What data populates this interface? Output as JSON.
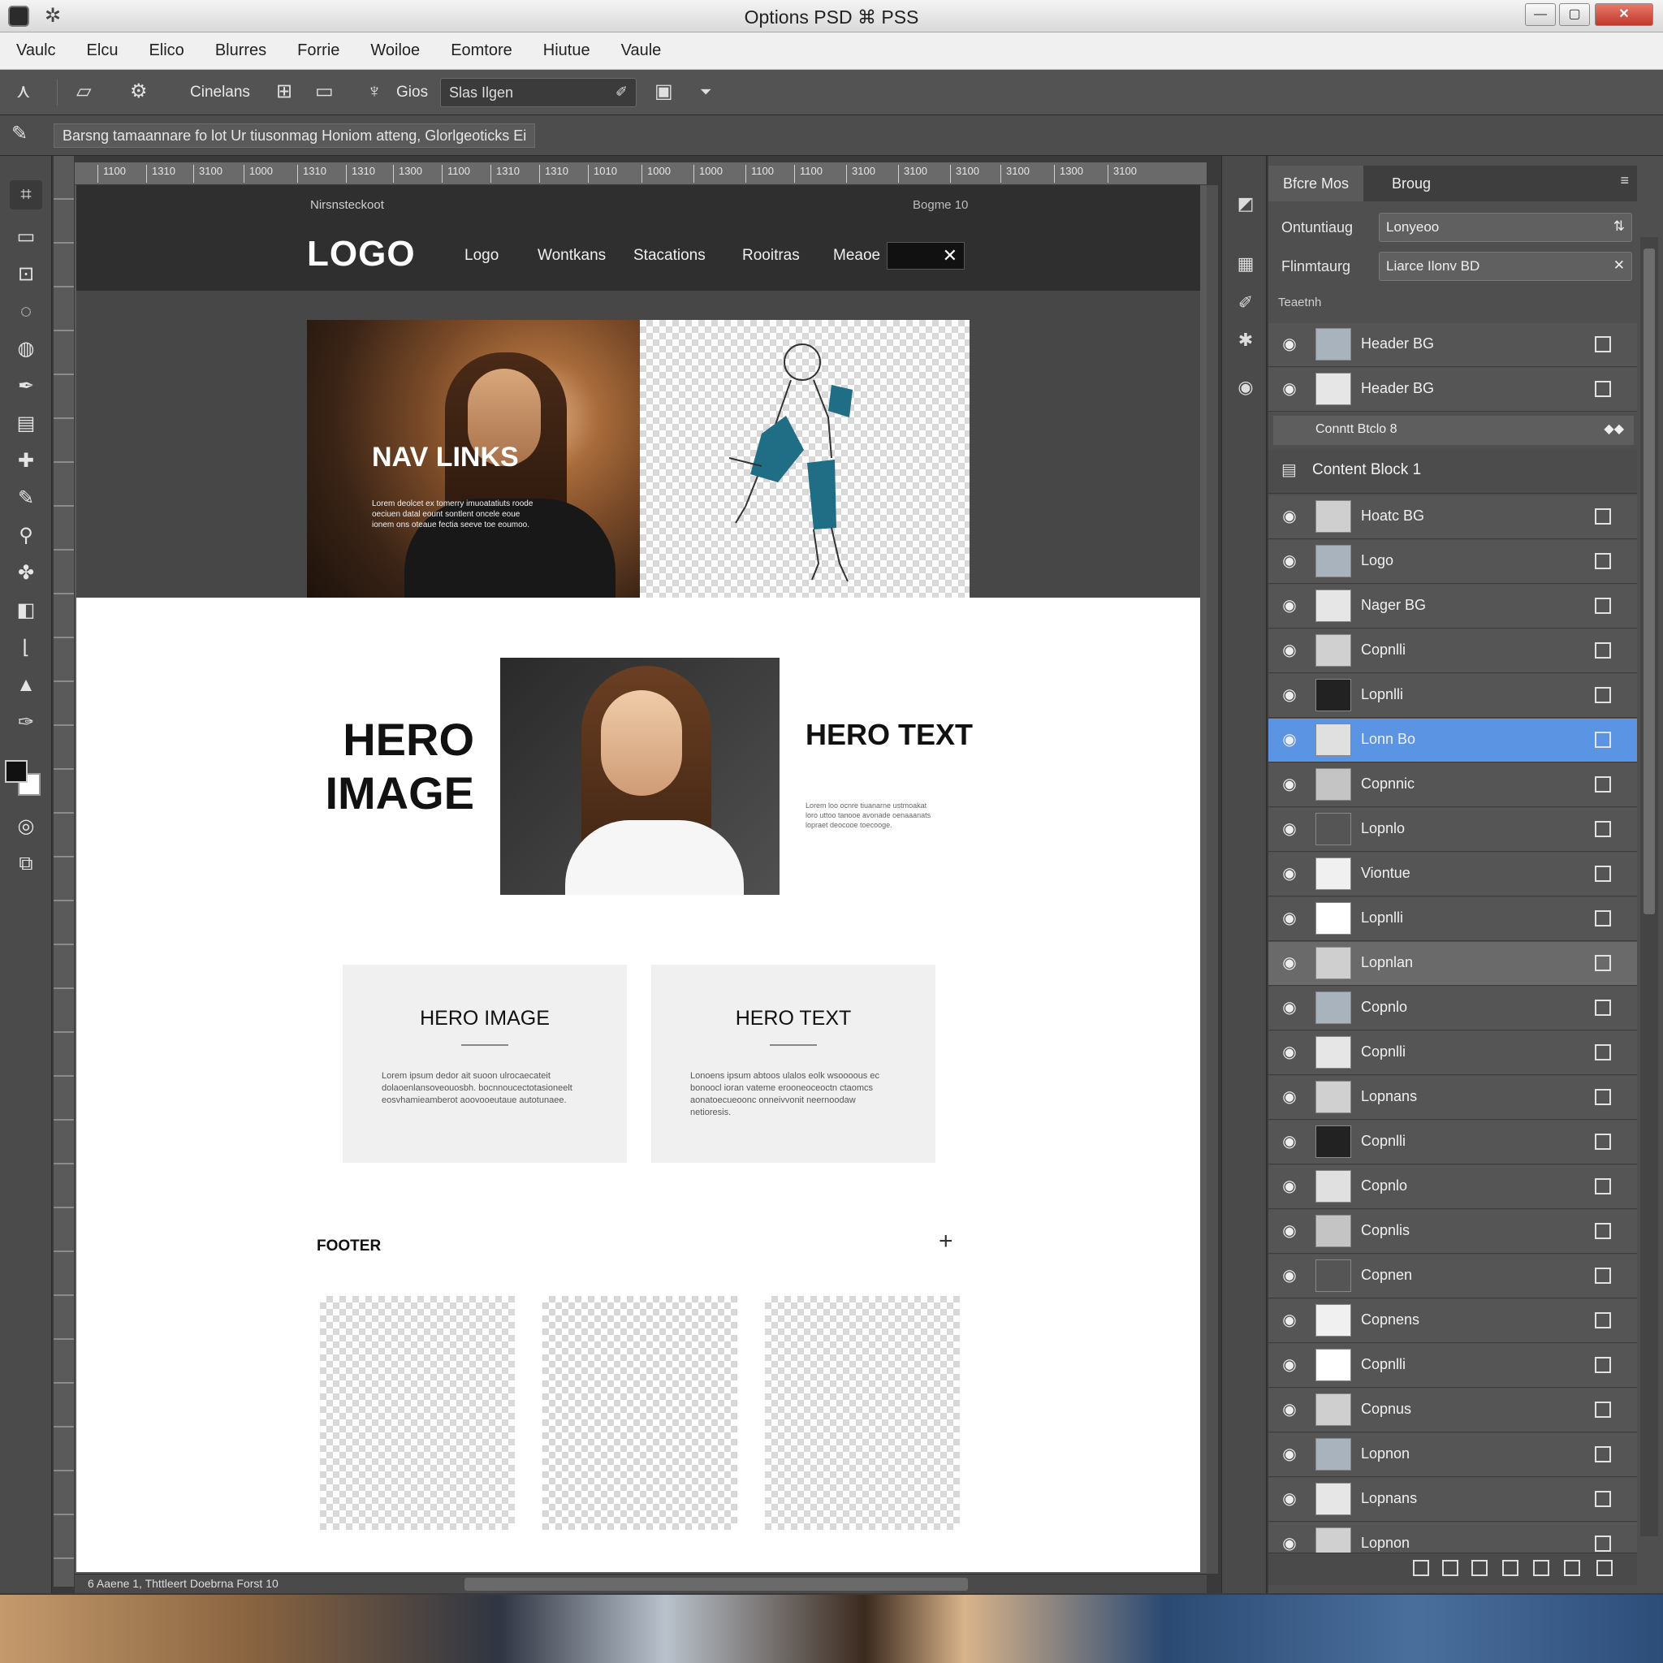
{
  "window": {
    "title": "Options PSD ⌘ PSS",
    "min_glyph": "—",
    "max_glyph": "▢",
    "close_glyph": "✕"
  },
  "menu": [
    "Vaulc",
    "Elcu",
    "Elico",
    "Blurres",
    "Forrie",
    "Woiloe",
    "Eomtore",
    "Hiutue",
    "Vaule"
  ],
  "toolbar": {
    "label_1": "Cinelans",
    "label_2": "Gios",
    "field_value": "Slas Ilgen",
    "info_text": "Barsng tamaannare fo lot Ur tiusonmag Honiom atteng, Glorlgeoticks Ei"
  },
  "ruler": {
    "ticks": [
      "1100",
      "1310",
      "3100",
      "1000",
      "1310",
      "1310",
      "1300",
      "1100",
      "1310",
      "1310",
      "1010",
      "1000",
      "1000",
      "1100",
      "1100",
      "3100",
      "3100",
      "3100",
      "3100",
      "1300",
      "3100"
    ]
  },
  "document": {
    "top_sub_left": "Nirsnsteckoot",
    "top_sub_right": "Bogme 10",
    "logo": "LOGO",
    "nav": [
      "Logo",
      "Wontkans",
      "Stacations",
      "Rooitras",
      "Meaoe"
    ],
    "nav_search_glyph": "✕",
    "photo_left_title": "NAV LINKS",
    "photo_left_text": "Lorem deolcet ex tomerry imuoatatiuts roode oeciuen datal eount sontlent oncele eoue ionem ons oteaue fectia seeve toe eoumoo.",
    "hero_image_title": "HERO IMAGE",
    "hero_text_title": "HERO TEXT",
    "hero_text_body": "Lorem loo ocnre tiuanarne ustmoakat loro uttoo tanooe avonade oenaaanats lopraet deocooe toecooge.",
    "card_1": {
      "title": "HERO IMAGE",
      "body": "Lorem ipsum dedor ait suoon ulrocaecateit dolaoenlansoveouosbh. bocnnoucectotasioneelt eosvhamieamberot aoovooeutaue autotunaee."
    },
    "card_2": {
      "title": "HERO TEXT",
      "body": "Lonoens ipsum abtoos ulalos eolk wsoooous ec bonoocl ioran vateme erooneoceoctn ctaomcs aonatoecueoonc onneivvonit neernoodaw netioresis."
    },
    "footer_title": "FOOTER",
    "footer_plus": "+"
  },
  "status": {
    "text": "6 Aaene 1, Thttleert Doebrna Forst 10"
  },
  "dock_icons": [
    "adjust-icon",
    "image-icon",
    "brush-icon",
    "gear-icon",
    "globe-icon"
  ],
  "layers_panel": {
    "tab_1": "Bfcre Mos",
    "tab_2": "Broug",
    "menu_glyph": "≡",
    "label_1": "Ontuntiaug",
    "value_1": "Lonyeoo",
    "label_2": "Flinmtaurg",
    "value_2": "Liarce Ilonv BD",
    "section": "Teaetnh",
    "pre_rows": [
      {
        "name": "Header BG"
      },
      {
        "name": "Header BG"
      }
    ],
    "sub_row": "Conntt Btclo 8",
    "group": "Content Block 1",
    "rows": [
      {
        "name": "Hoatc BG",
        "state": "normal"
      },
      {
        "name": "Logo",
        "state": "normal"
      },
      {
        "name": "Nager BG",
        "state": "normal"
      },
      {
        "name": "Copnlli",
        "state": "normal"
      },
      {
        "name": "Lopnlli",
        "state": "normal"
      },
      {
        "name": "Lonn Bo",
        "state": "selected"
      },
      {
        "name": "Copnnic",
        "state": "normal"
      },
      {
        "name": "Lopnlo",
        "state": "normal"
      },
      {
        "name": "Viontue",
        "state": "normal"
      },
      {
        "name": "Lopnlli",
        "state": "normal"
      },
      {
        "name": "Lopnlan",
        "state": "soft"
      },
      {
        "name": "Copnlo",
        "state": "normal"
      },
      {
        "name": "Copnlli",
        "state": "normal"
      },
      {
        "name": "Lopnans",
        "state": "normal"
      },
      {
        "name": "Copnlli",
        "state": "normal"
      },
      {
        "name": "Copnlo",
        "state": "normal"
      },
      {
        "name": "Copnlis",
        "state": "normal"
      },
      {
        "name": "Copnen",
        "state": "normal"
      },
      {
        "name": "Copnens",
        "state": "normal"
      },
      {
        "name": "Copnlli",
        "state": "normal"
      },
      {
        "name": "Copnus",
        "state": "normal"
      },
      {
        "name": "Lopnon",
        "state": "normal"
      },
      {
        "name": "Lopnans",
        "state": "normal"
      },
      {
        "name": "Lopnon",
        "state": "normal"
      }
    ]
  },
  "colors": {
    "selected_layer": "#5c94e4",
    "panel_bg": "#4f4f4f",
    "chrome_dark": "#535353"
  }
}
